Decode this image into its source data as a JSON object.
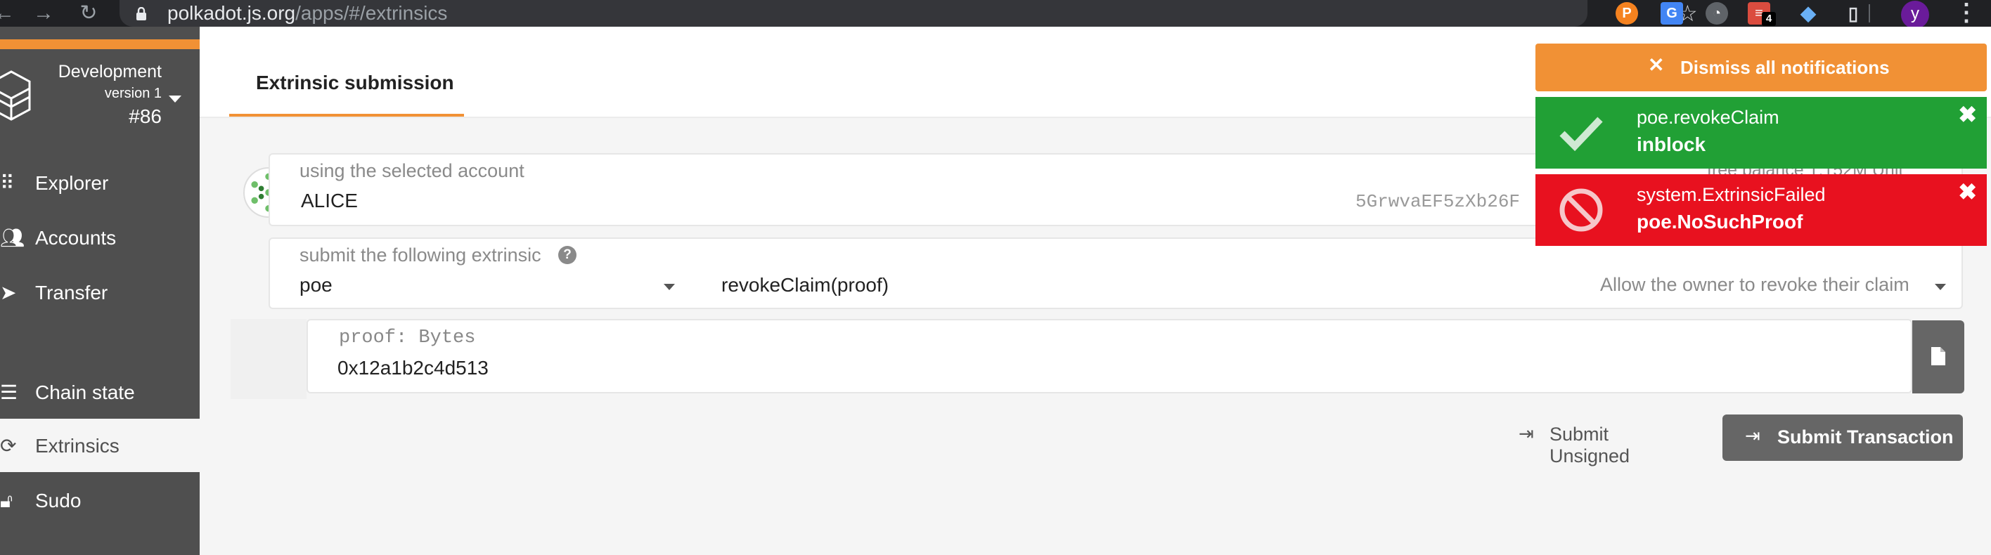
{
  "browser": {
    "url_host": "polkadot.js.org",
    "url_path": "/apps/#/extrinsics",
    "extensions": [
      {
        "name": "polkadot-ext-icon",
        "color": "#f5821f",
        "glyph": "P"
      },
      {
        "name": "translate-ext-icon",
        "color": "#4285f4",
        "glyph": "G"
      },
      {
        "name": "bulb-ext-icon",
        "color": "#5f6368",
        "glyph": "◔"
      },
      {
        "name": "todoist-ext-icon",
        "color": "#db4c3f",
        "glyph": "≡",
        "badge": "4"
      },
      {
        "name": "gem-ext-icon",
        "color": "#6ab0f5",
        "glyph": "◆"
      },
      {
        "name": "bookmark-ext-icon",
        "color": "#dadce0",
        "glyph": "▯"
      }
    ],
    "profile_initial": "y"
  },
  "node": {
    "chain": "Development",
    "version": "version 1",
    "block": "#86"
  },
  "sidebar": {
    "items": [
      {
        "label": "Explorer",
        "icon": "grid-icon"
      },
      {
        "label": "Accounts",
        "icon": "users-icon"
      },
      {
        "label": "Transfer",
        "icon": "send-icon"
      },
      {
        "label": "Chain state",
        "icon": "database-icon"
      },
      {
        "label": "Extrinsics",
        "icon": "sync-icon"
      },
      {
        "label": "Sudo",
        "icon": "unlock-icon"
      }
    ]
  },
  "tabs": {
    "active": "Extrinsic submission"
  },
  "account": {
    "label": "using the selected account",
    "name": "ALICE",
    "address": "5GrwvaEF5zXb26F",
    "balance_fragment": "free balance 1.152M Unit"
  },
  "extrinsic": {
    "label": "submit the following extrinsic",
    "module": "poe",
    "method": "revokeClaim(proof)",
    "description": "Allow the owner to revoke their claim"
  },
  "param": {
    "label": "proof: Bytes",
    "value": "0x12a1b2c4d513"
  },
  "actions": {
    "unsigned_label": "Submit Unsigned",
    "submit_label": "Submit Transaction"
  },
  "notifications": {
    "dismiss_label": "Dismiss all notifications",
    "items": [
      {
        "title": "poe.revokeClaim",
        "status": "inblock",
        "color": "#21a035"
      },
      {
        "title": "system.ExtrinsicFailed",
        "status": "poe.NoSuchProof",
        "color": "#e8111f"
      }
    ]
  }
}
